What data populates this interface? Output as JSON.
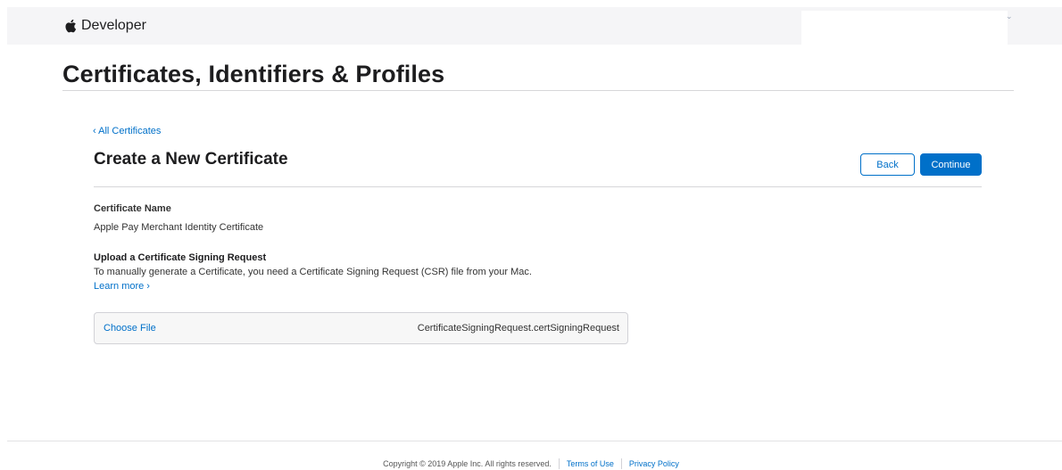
{
  "header": {
    "brand_label": "Developer"
  },
  "page": {
    "title": "Certificates, Identifiers & Profiles"
  },
  "content": {
    "back_link": "‹ All Certificates",
    "section_title": "Create a New Certificate",
    "buttons": {
      "back": "Back",
      "continue": "Continue"
    },
    "certificate_name_label": "Certificate Name",
    "certificate_name_value": "Apple Pay Merchant Identity Certificate",
    "upload": {
      "label": "Upload a Certificate Signing Request",
      "description": "To manually generate a Certificate, you need a Certificate Signing Request (CSR) file from your Mac.",
      "learn_more": "Learn more ›",
      "choose_file": "Choose File",
      "file_name": "CertificateSigningRequest.certSigningRequest"
    }
  },
  "footer": {
    "copyright": "Copyright © 2019 Apple Inc. All rights reserved.",
    "terms": "Terms of Use",
    "privacy": "Privacy Policy"
  },
  "colors": {
    "accent": "#0070c9",
    "topbar_bg": "#f5f5f7",
    "text": "#1d1d1f"
  }
}
